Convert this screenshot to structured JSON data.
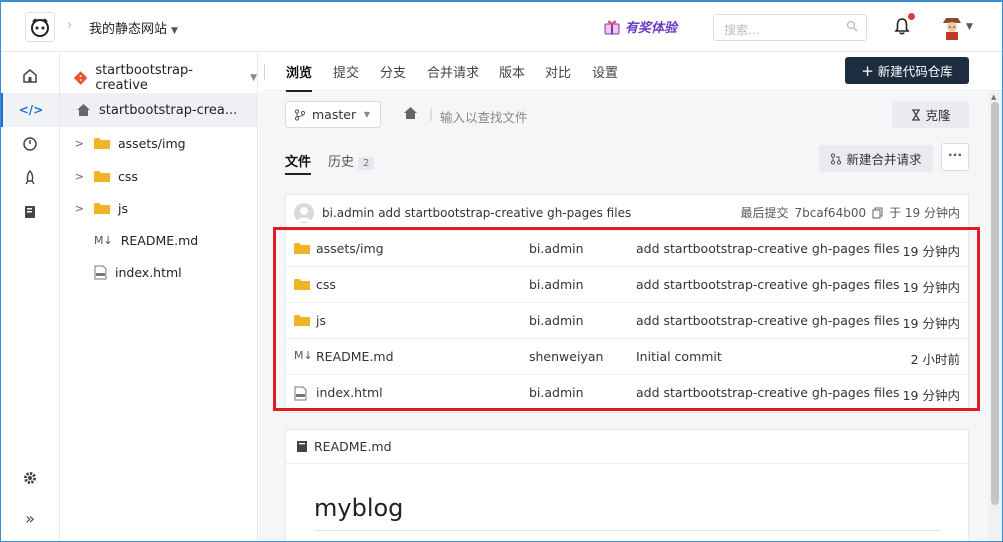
{
  "header": {
    "site_name": "我的静态网站",
    "promo_label": "有奖体验",
    "search_placeholder": "搜索..."
  },
  "repo": {
    "name": "startbootstrap-creative"
  },
  "tabs": [
    {
      "label": "浏览"
    },
    {
      "label": "提交"
    },
    {
      "label": "分支"
    },
    {
      "label": "合并请求"
    },
    {
      "label": "版本"
    },
    {
      "label": "对比"
    },
    {
      "label": "设置"
    }
  ],
  "new_repo_label": "新建代码仓库",
  "tree": {
    "root": "startbootstrap-crea...",
    "items": [
      {
        "label": "assets/img",
        "type": "folder"
      },
      {
        "label": "css",
        "type": "folder"
      },
      {
        "label": "js",
        "type": "folder"
      },
      {
        "label": "README.md",
        "type": "markdown"
      },
      {
        "label": "index.html",
        "type": "html"
      }
    ]
  },
  "toolbar": {
    "branch": "master",
    "find_placeholder": "输入以查找文件",
    "clone_label": "克隆"
  },
  "subtabs": {
    "files": "文件",
    "history": "历史",
    "history_count": "2"
  },
  "new_mr_label": "新建合并请求",
  "last_commit": {
    "author": "bi.admin",
    "message": "add startbootstrap-creative gh-pages files",
    "label": "最后提交",
    "hash": "7bcaf64b00",
    "time": "于 19 分钟内"
  },
  "files": [
    {
      "name": "assets/img",
      "type": "folder",
      "author": "bi.admin",
      "message": "add startbootstrap-creative gh-pages files",
      "time": "19 分钟内"
    },
    {
      "name": "css",
      "type": "folder",
      "author": "bi.admin",
      "message": "add startbootstrap-creative gh-pages files",
      "time": "19 分钟内"
    },
    {
      "name": "js",
      "type": "folder",
      "author": "bi.admin",
      "message": "add startbootstrap-creative gh-pages files",
      "time": "19 分钟内"
    },
    {
      "name": "README.md",
      "type": "markdown",
      "author": "shenweiyan",
      "message": "Initial commit",
      "time": "2 小时前"
    },
    {
      "name": "index.html",
      "type": "html",
      "author": "bi.admin",
      "message": "add startbootstrap-creative gh-pages files",
      "time": "19 分钟内"
    }
  ],
  "readme": {
    "filename": "README.md",
    "title": "myblog"
  },
  "colors": {
    "accent": "#1d2c3f",
    "highlight": "#e01b24",
    "folder": "#f0b429",
    "promo": "#6a3fc6"
  }
}
